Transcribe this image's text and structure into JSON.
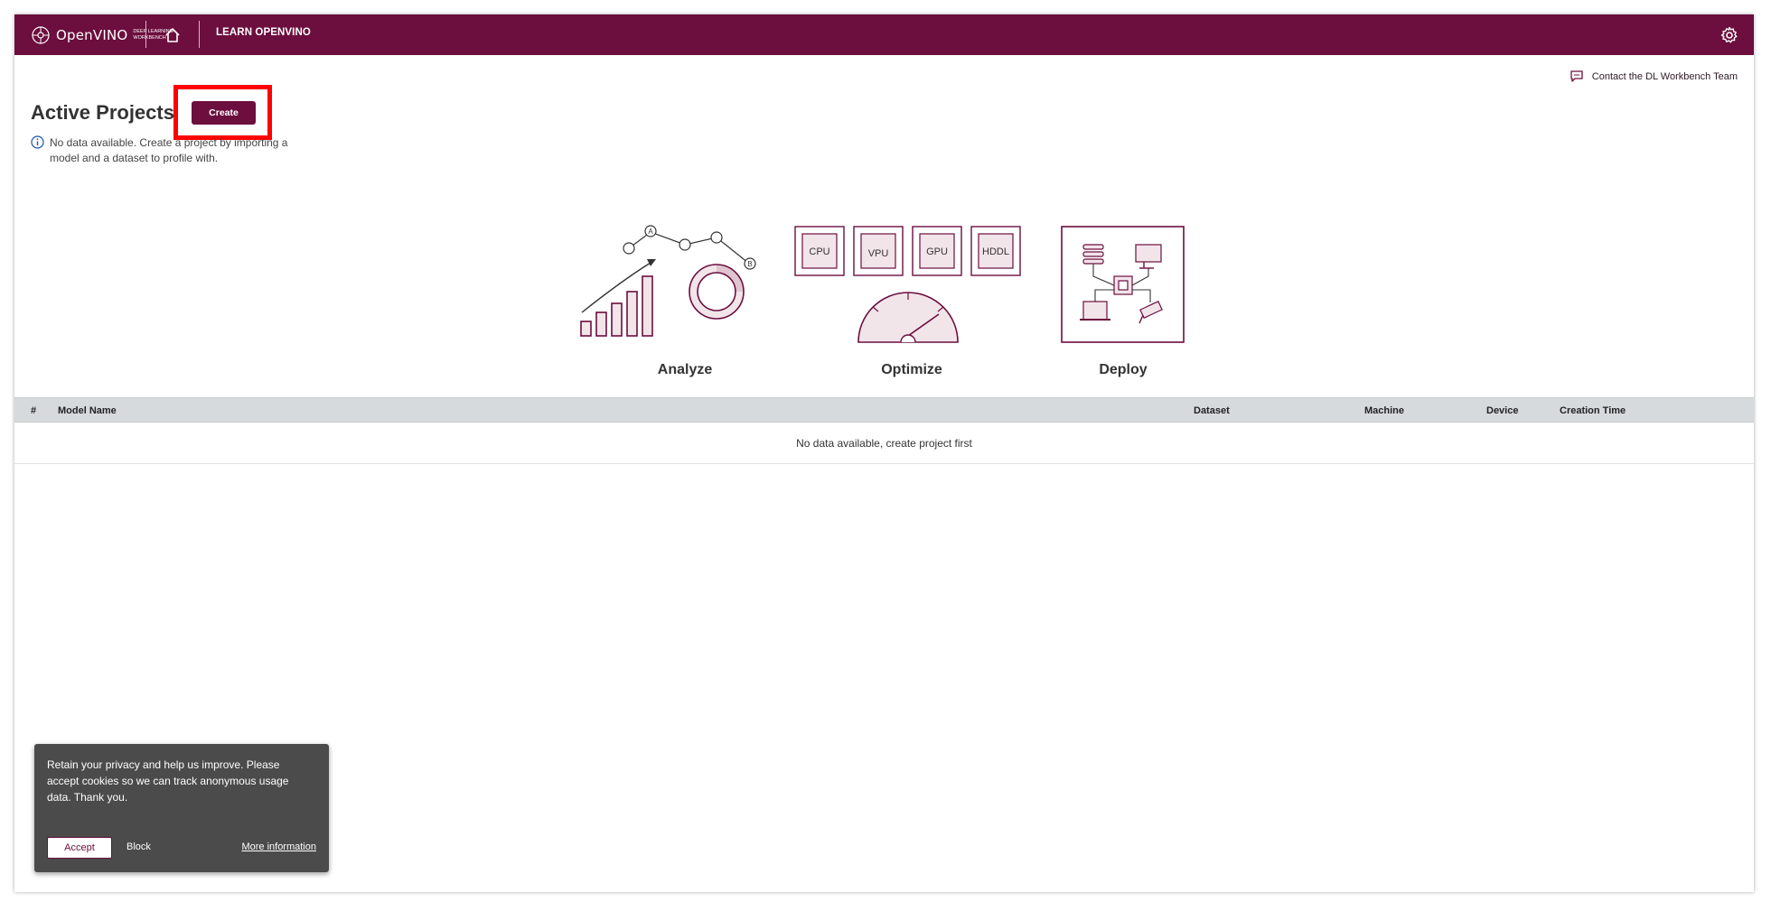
{
  "header": {
    "logo_text": "OpenVINO",
    "logo_sub_line1": "DEEP LEARNING",
    "logo_sub_line2": "WORKBENCH",
    "learn_label": "LEARN OPENVINO",
    "background": "#6c0e3e"
  },
  "contact": {
    "label": "Contact the DL Workbench Team"
  },
  "projects": {
    "title": "Active Projects",
    "create_label": "Create",
    "info_text": "No data available. Create a project by importing a model and a dataset to profile with."
  },
  "illustrations": {
    "analyze": {
      "label": "Analyze",
      "markers": [
        "A",
        "B"
      ]
    },
    "optimize": {
      "label": "Optimize",
      "chips": [
        "CPU",
        "VPU",
        "GPU",
        "HDDL"
      ]
    },
    "deploy": {
      "label": "Deploy"
    }
  },
  "table": {
    "columns": [
      "#",
      "Model Name",
      "Dataset",
      "Machine",
      "Device",
      "Creation Time"
    ],
    "empty_text": "No data available, create project first"
  },
  "cookie": {
    "text": "Retain your privacy and help us improve. Please accept cookies so we can track anonymous usage data. Thank you.",
    "accept_label": "Accept",
    "block_label": "Block",
    "more_label": "More information"
  },
  "colors": {
    "accent": "#6c0e3e",
    "accent_light": "#f2e5ea",
    "highlight": "#ff0000"
  }
}
